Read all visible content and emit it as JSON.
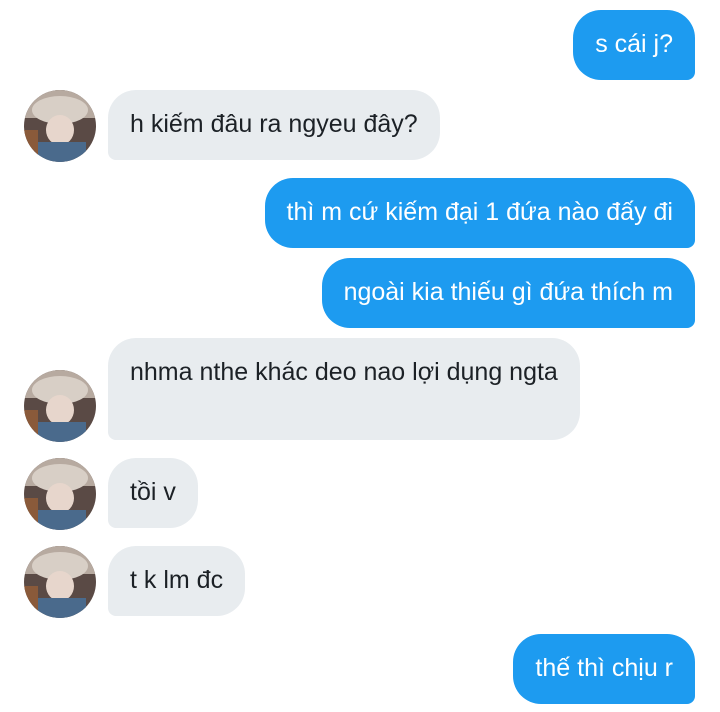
{
  "conversation": {
    "messages": [
      {
        "side": "sent",
        "text": "s cái j?"
      },
      {
        "side": "received",
        "text": "h kiếm đâu ra ngyeu đây?"
      },
      {
        "side": "sent",
        "text": "thì m cứ kiếm đại 1 đứa nào đấy đi"
      },
      {
        "side": "sent",
        "text": "ngoài kia thiếu gì đứa thích m"
      },
      {
        "side": "received",
        "text": "nhma nthe khác deo nao lợi dụng ngta"
      },
      {
        "side": "received",
        "text": "tồi v"
      },
      {
        "side": "received",
        "text": "t k lm đc"
      },
      {
        "side": "sent",
        "text": "thế thì chịu r"
      }
    ]
  },
  "colors": {
    "sent_bubble": "#1d9bf0",
    "received_bubble": "#e8ecef",
    "sent_text": "#ffffff",
    "received_text": "#1c2126"
  },
  "icons": {
    "avatar": "profile-photo-icon"
  }
}
